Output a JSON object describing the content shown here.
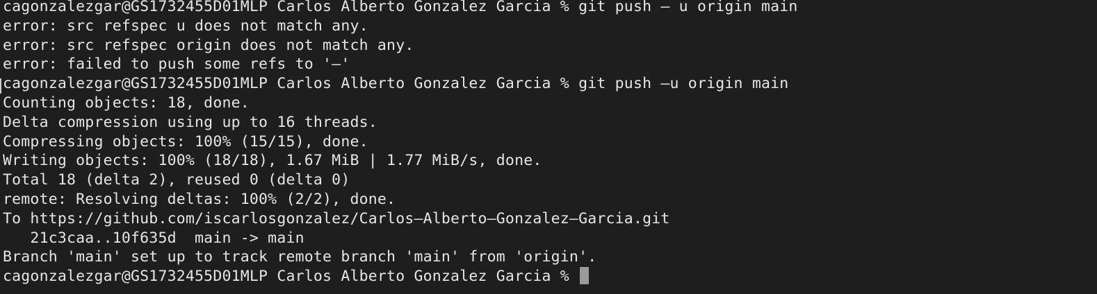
{
  "terminal": {
    "lines": [
      "cagonzalezgar@GS1732455D01MLP Carlos Alberto Gonzalez Garcia % git push – u origin main",
      "error: src refspec u does not match any.",
      "error: src refspec origin does not match any.",
      "error: failed to push some refs to '–'",
      "cagonzalezgar@GS1732455D01MLP Carlos Alberto Gonzalez Garcia % git push –u origin main",
      "Counting objects: 18, done.",
      "Delta compression using up to 16 threads.",
      "Compressing objects: 100% (15/15), done.",
      "Writing objects: 100% (18/18), 1.67 MiB | 1.77 MiB/s, done.",
      "Total 18 (delta 2), reused 0 (delta 0)",
      "remote: Resolving deltas: 100% (2/2), done.",
      "To https://github.com/iscarlosgonzalez/Carlos–Alberto–Gonzalez–Garcia.git",
      "   21c3caa..10f635d  main -> main",
      "Branch 'main' set up to track remote branch 'main' from 'origin'.",
      "cagonzalezgar@GS1732455D01MLP Carlos Alberto Gonzalez Garcia % "
    ]
  }
}
